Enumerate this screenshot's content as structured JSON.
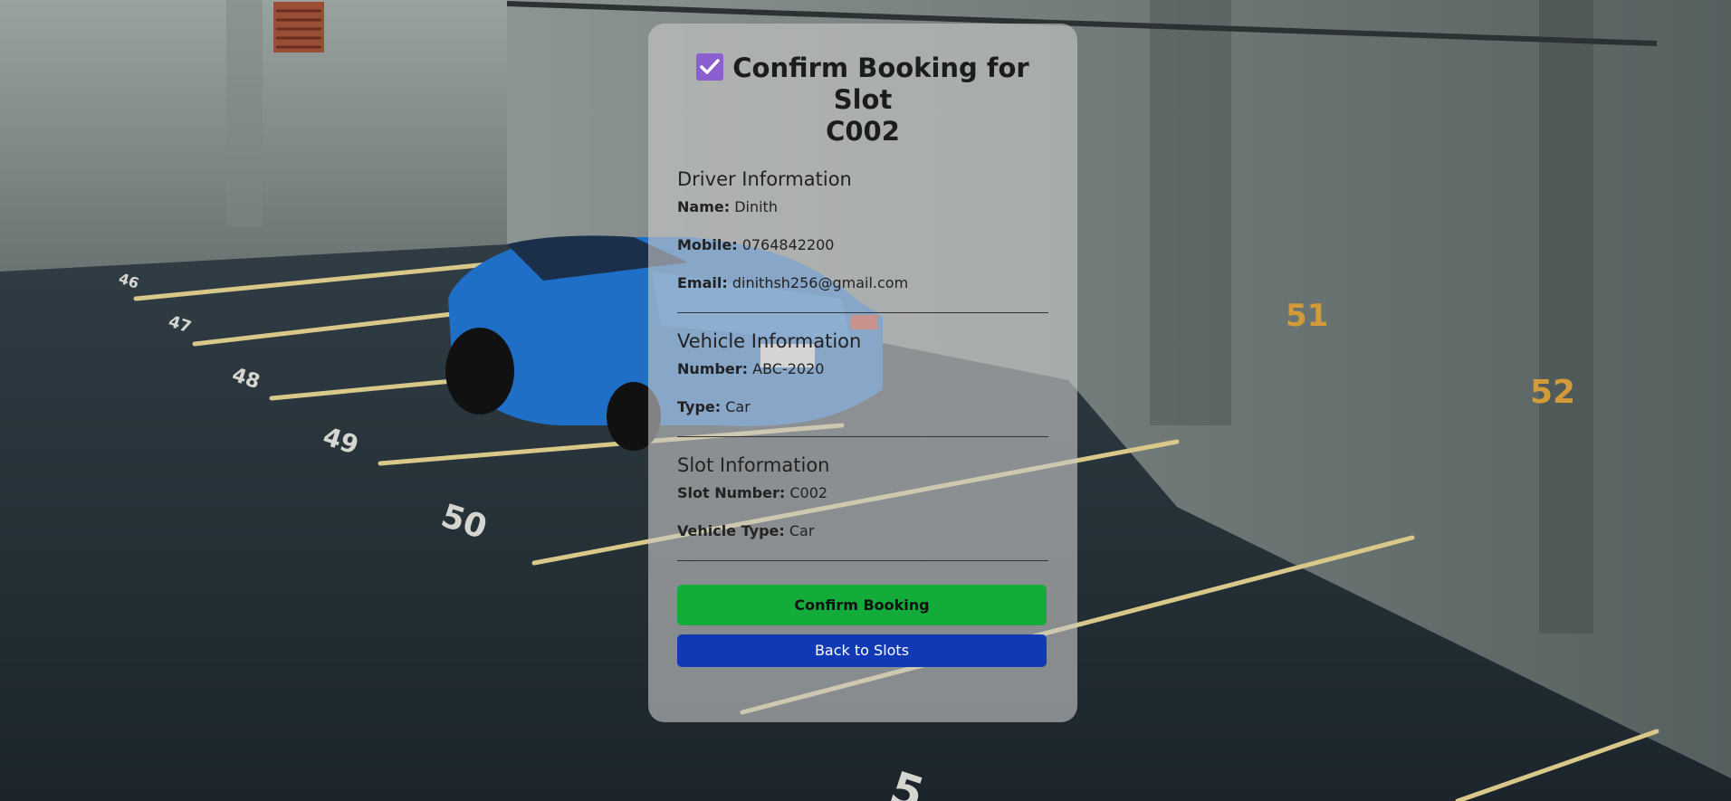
{
  "page": {
    "title_line1": "Confirm Booking for Slot",
    "title_line2": "C002",
    "title_icon": "checkbox-checked-icon"
  },
  "driver": {
    "heading": "Driver Information",
    "name_label": "Name:",
    "name": "Dinith",
    "mobile_label": "Mobile:",
    "mobile": "0764842200",
    "email_label": "Email:",
    "email": "dinithsh256@gmail.com"
  },
  "vehicle": {
    "heading": "Vehicle Information",
    "number_label": "Number:",
    "number": "ABC-2020",
    "type_label": "Type:",
    "type": "Car"
  },
  "slot": {
    "heading": "Slot Information",
    "number_label": "Slot Number:",
    "number": "C002",
    "vehicle_type_label": "Vehicle Type:",
    "vehicle_type": "Car"
  },
  "actions": {
    "confirm_label": "Confirm Booking",
    "back_label": "Back to Slots"
  },
  "colors": {
    "confirm": "#13ab3a",
    "back": "#1138b5",
    "icon": "#8c5fd0"
  }
}
